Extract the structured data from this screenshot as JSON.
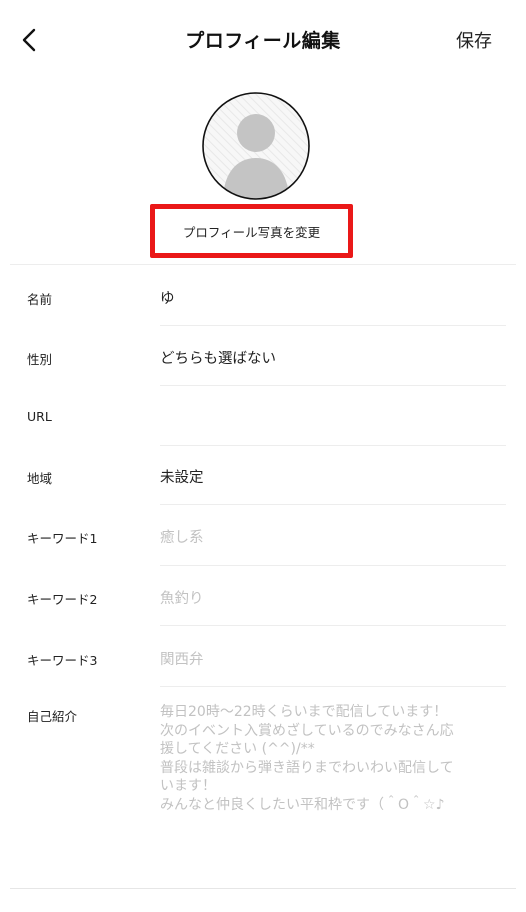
{
  "header": {
    "title": "プロフィール編集",
    "save_label": "保存"
  },
  "avatar": {
    "change_photo_label": "プロフィール写真を変更",
    "highlight_color": "#ea1818"
  },
  "fields": {
    "name": {
      "label": "名前",
      "value": "ゆ"
    },
    "gender": {
      "label": "性別",
      "value": "どちらも選ばない"
    },
    "url": {
      "label": "URL",
      "value": ""
    },
    "region": {
      "label": "地域",
      "value": "未設定"
    },
    "keyword1": {
      "label": "キーワード1",
      "placeholder": "癒し系"
    },
    "keyword2": {
      "label": "キーワード2",
      "placeholder": "魚釣り"
    },
    "keyword3": {
      "label": "キーワード3",
      "placeholder": "関西弁"
    },
    "bio": {
      "label": "自己紹介",
      "placeholder": "毎日20時〜22時くらいまで配信しています！\n次のイベント入賞めざしているのでみなさん応\n援してください (^^)/**\n普段は雑談から弾き語りまでわいわい配信して\nいます！\nみんなと仲良くしたい平和枠です（＾O＾☆♪"
    }
  }
}
